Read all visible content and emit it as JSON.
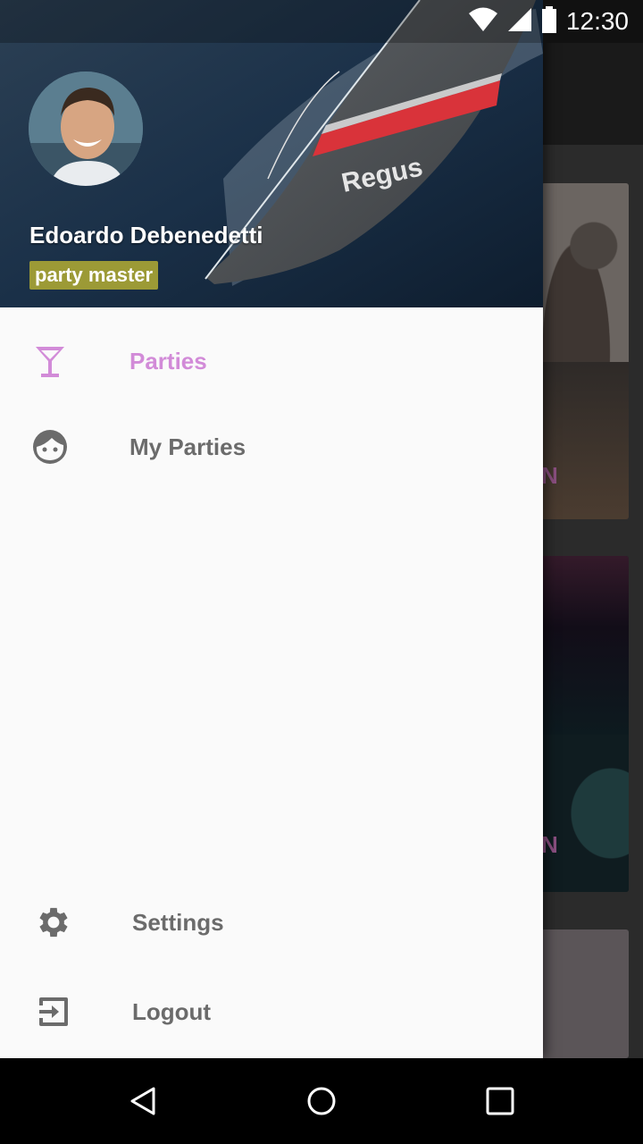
{
  "status_bar": {
    "time": "12:30"
  },
  "drawer": {
    "user": {
      "name": "Edoardo Debenedetti",
      "role_badge": "party master"
    },
    "header_image_text": "Regus",
    "primary_items": [
      {
        "label": "Parties",
        "icon": "cocktail-glass-icon",
        "active": true
      },
      {
        "label": "My Parties",
        "icon": "face-icon",
        "active": false
      }
    ],
    "secondary_items": [
      {
        "label": "Settings",
        "icon": "gear-icon"
      },
      {
        "label": "Logout",
        "icon": "exit-icon"
      }
    ]
  },
  "background_cards": [
    {
      "letter": "N"
    },
    {
      "letter": "N"
    }
  ],
  "colors": {
    "accent": "#d28bd8",
    "badge": "#9c9a36",
    "drawer_bg": "#fafafa",
    "item_text": "#6b6b6b"
  },
  "system_nav": {
    "buttons": [
      "back-icon",
      "home-icon",
      "recents-icon"
    ]
  }
}
